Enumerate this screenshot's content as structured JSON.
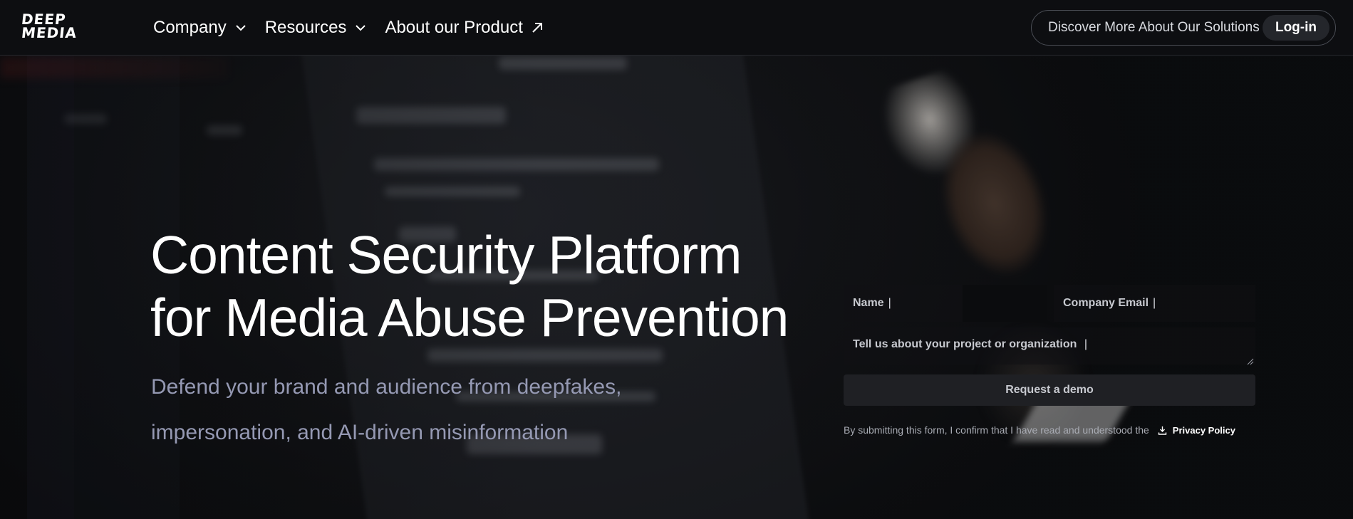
{
  "brand": {
    "logo_line1": "DEEP",
    "logo_line2": "MEDIA"
  },
  "nav": {
    "company": "Company",
    "resources": "Resources",
    "about": "About our Product"
  },
  "header_cta": {
    "discover": "Discover More About Our Solutions",
    "login": "Log-in"
  },
  "hero": {
    "title_line1": "Content Security Platform",
    "title_line2": "for Media Abuse Prevention",
    "subtitle_line1": "Defend your brand and audience from deepfakes,",
    "subtitle_line2": "impersonation, and AI-driven misinformation"
  },
  "form": {
    "name_placeholder": "Name",
    "email_placeholder": "Company Email",
    "project_placeholder": "Tell us about your project or organization",
    "caret": "|",
    "submit_label": "Request a demo",
    "disclaimer": "By submitting this form, I confirm that I have read and understood the",
    "privacy_label": "Privacy Policy"
  },
  "icons": {
    "chevron": "chevron-down-icon",
    "external": "arrow-up-right-icon",
    "download": "download-icon"
  },
  "colors": {
    "background": "#0d0e11",
    "subtitle": "#9599b3",
    "button": "#1f2024",
    "pill_border": "#4a4d55"
  }
}
